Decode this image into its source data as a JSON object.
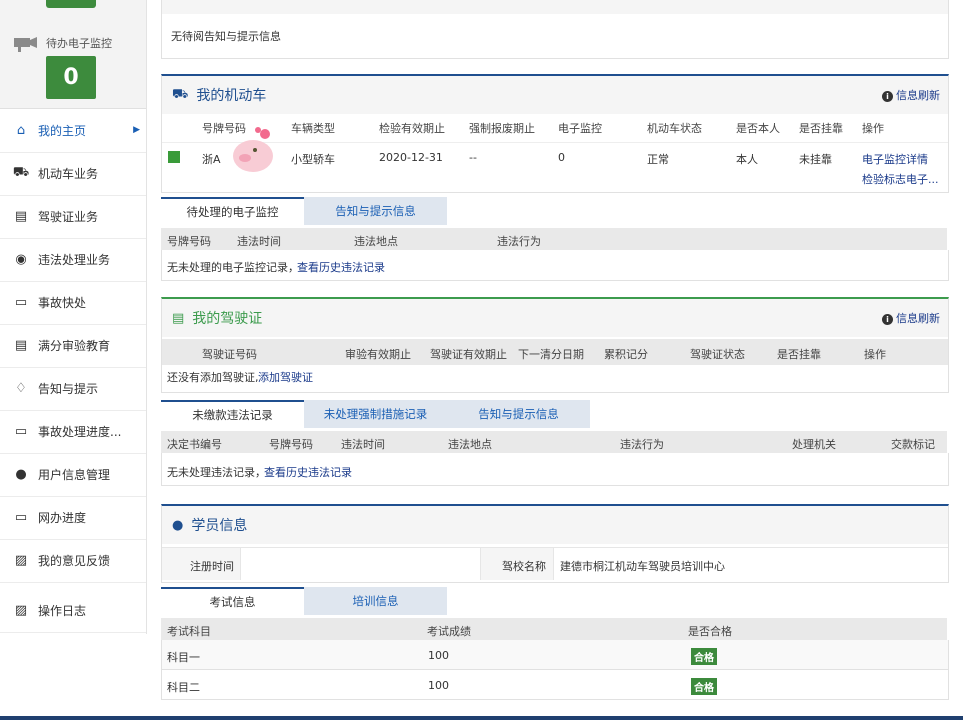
{
  "sidebar": {
    "monitor_label": "待办电子监控",
    "monitor_count": "0",
    "items": [
      {
        "label": "我的主页",
        "icon": "home-icon",
        "active": true
      },
      {
        "label": "机动车业务",
        "icon": "truck-icon"
      },
      {
        "label": "驾驶证业务",
        "icon": "id-card-icon"
      },
      {
        "label": "违法处理业务",
        "icon": "camera-icon"
      },
      {
        "label": "事故快处",
        "icon": "card-icon"
      },
      {
        "label": "满分审验教育",
        "icon": "id-card-icon"
      },
      {
        "label": "告知与提示",
        "icon": "bell-icon"
      },
      {
        "label": "事故处理进度...",
        "icon": "card-icon"
      },
      {
        "label": "用户信息管理",
        "icon": "user-icon"
      },
      {
        "label": "网办进度",
        "icon": "card-icon"
      },
      {
        "label": "我的意见反馈",
        "icon": "feedback-icon"
      },
      {
        "label": "操作日志",
        "icon": "feedback-icon"
      }
    ]
  },
  "notice": {
    "text": "无待阅告知与提示信息"
  },
  "vehicle": {
    "title": "我的机动车",
    "refresh": "信息刷新",
    "headers": [
      "号牌号码",
      "车辆类型",
      "检验有效期止",
      "强制报废期止",
      "电子监控",
      "机动车状态",
      "是否本人",
      "是否挂靠",
      "操作"
    ],
    "row": {
      "plate": "浙A",
      "type": "小型轿车",
      "inspect": "2020-12-31",
      "scrap": "--",
      "monitor": "0",
      "status": "正常",
      "owner": "本人",
      "affiliated": "未挂靠",
      "op1": "电子监控详情",
      "op2": "检验标志电子..."
    },
    "tabs": [
      "待处理的电子监控",
      "告知与提示信息"
    ],
    "sub_headers": [
      "号牌号码",
      "违法时间",
      "违法地点",
      "违法行为"
    ],
    "empty_text": "无未处理的电子监控记录，",
    "history_link": "查看历史违法记录"
  },
  "license": {
    "title": "我的驾驶证",
    "refresh": "信息刷新",
    "headers": [
      "驾驶证号码",
      "审验有效期止",
      "驾驶证有效期止",
      "下一清分日期",
      "累积记分",
      "驾驶证状态",
      "是否挂靠",
      "操作"
    ],
    "empty_text": "还没有添加驾驶证,",
    "add_link": "添加驾驶证",
    "tabs": [
      "未缴款违法记录",
      "未处理强制措施记录",
      "告知与提示信息"
    ],
    "sub_headers": [
      "决定书编号",
      "号牌号码",
      "违法时间",
      "违法地点",
      "违法行为",
      "处理机关",
      "交款标记"
    ],
    "sub_empty": "无未处理违法记录，",
    "history_link": "查看历史违法记录"
  },
  "student": {
    "title": "学员信息",
    "reg_label": "注册时间",
    "reg_value": "",
    "school_label": "驾校名称",
    "school_value": "建德市桐江机动车驾驶员培训中心",
    "tabs": [
      "考试信息",
      "培训信息"
    ],
    "headers": [
      "考试科目",
      "考试成绩",
      "是否合格"
    ],
    "rows": [
      {
        "subject": "科目一",
        "score": "100",
        "result": "合格"
      },
      {
        "subject": "科目二",
        "score": "100",
        "result": "合格"
      }
    ]
  }
}
